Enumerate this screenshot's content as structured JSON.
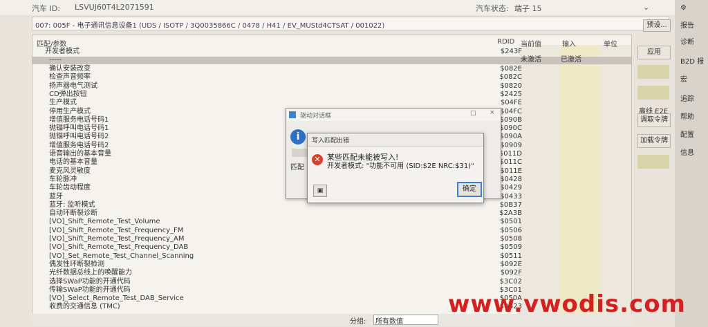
{
  "header": {
    "vin_label": "汽车 ID:",
    "vin_value": "LSVUJ60T4L2071591",
    "status_label": "汽车状态:",
    "status_value": "端子 15"
  },
  "path": {
    "text": "007: 005F - 电子通讯信息设备1  (UDS / ISOTP / 3Q0035866C / 0478 / H41 / EV_MUStd4CTSAT / 001022)",
    "preset_label": "预设..."
  },
  "table": {
    "headers": {
      "param": "匹配/参数",
      "rdid": "RDID",
      "current": "当前值",
      "input": "输入",
      "unit": "单位"
    },
    "group": {
      "name": "开发者模式",
      "id": "$243F"
    },
    "selected": {
      "name": "-----",
      "current": "未激活",
      "input": "已激活"
    },
    "rows": [
      {
        "name": "确认安装改变",
        "id": "$082E"
      },
      {
        "name": "检查声音频率",
        "id": "$082C"
      },
      {
        "name": "扬声器电气测试",
        "id": "$0820"
      },
      {
        "name": "CD弹出按钮",
        "id": "$2425"
      },
      {
        "name": "生产模式",
        "id": "$04FE"
      },
      {
        "name": "停用生产模式",
        "id": "$04FC"
      },
      {
        "name": "增值服务电话号码1",
        "id": "$090B"
      },
      {
        "name": "抛锚呼叫电话号码1",
        "id": "$090C"
      },
      {
        "name": "抛锚呼叫电话号码2",
        "id": "$090A"
      },
      {
        "name": "增值服务电话号码2",
        "id": "$0909"
      },
      {
        "name": "语音输出的基本音量",
        "id": "$011D"
      },
      {
        "name": "电话的基本音量",
        "id": "$011C"
      },
      {
        "name": "麦克风灵敏度",
        "id": "$011E"
      },
      {
        "name": "车轮脉冲",
        "id": "$0428"
      },
      {
        "name": "车轮齿动程度",
        "id": "$0429"
      },
      {
        "name": "蓝牙",
        "id": "$0433"
      },
      {
        "name": "蓝牙: 监听模式",
        "id": "$0B37"
      },
      {
        "name": "自动环断裂诊断",
        "id": "$2A3B"
      },
      {
        "name": "[VO]_Shift_Remote_Test_Volume",
        "id": "$0501"
      },
      {
        "name": "[VO]_Shift_Remote_Test_Frequency_FM",
        "id": "$0506"
      },
      {
        "name": "[VO]_Shift_Remote_Test_Frequency_AM",
        "id": "$0508"
      },
      {
        "name": "[VO]_Shift_Remote_Test_Frequency_DAB",
        "id": "$0509"
      },
      {
        "name": "[VO]_Set_Remote_Test_Channel_Scanning",
        "id": "$0511"
      },
      {
        "name": "偶发性环断裂检测",
        "id": "$092E"
      },
      {
        "name": "光纤数据总线上的唤醒能力",
        "id": "$092F"
      },
      {
        "name": "选择SWaP功能的开通代码",
        "id": "$3C02"
      },
      {
        "name": "传输SWaP功能的开通代码",
        "id": "$3C01"
      },
      {
        "name": "[VO]_Select_Remote_Test_DAB_Service",
        "id": "$050A"
      },
      {
        "name": "收费的交通信息 (TMC)",
        "id": "$0B23"
      }
    ]
  },
  "right_buttons": {
    "apply": "应用",
    "offline": "离线 E2E",
    "read_token": "调取令牌",
    "load_token": "加载令牌"
  },
  "side_menu": [
    "报告",
    "诊断",
    "B2D 报",
    "宏",
    "追踪",
    "帮助",
    "配置",
    "信息"
  ],
  "bottom": {
    "group_label": "分组:",
    "group_value": "所有数值"
  },
  "dialog_back": {
    "title": "驱动对话框",
    "label": "匹配"
  },
  "dialog_error": {
    "title": "写入匹配出错",
    "line1": "某些匹配未能被写入!",
    "line2": "开发者模式: \"功能不可用 (SID:$2E NRC:$31)\"",
    "ok_label": "确定"
  },
  "watermark": "www.vwodis.com",
  "colors": {
    "error": "#d9402b",
    "info": "#2f6fc4",
    "watermark": "#d42020"
  }
}
